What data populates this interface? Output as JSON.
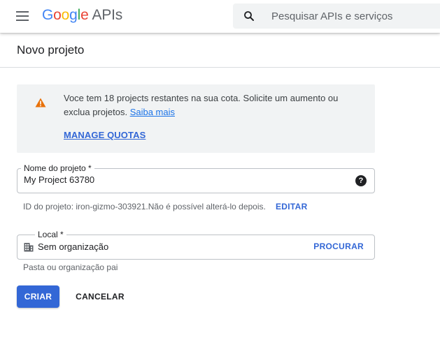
{
  "header": {
    "logo": {
      "letters": [
        "G",
        "o",
        "o",
        "g",
        "l",
        "e"
      ],
      "suffix": "APIs"
    },
    "search": {
      "placeholder": "Pesquisar APIs e serviços"
    }
  },
  "page": {
    "title": "Novo projeto"
  },
  "warning": {
    "text": "Voce tem 18 projects restantes na sua cota. Solicite um aumento ou exclua projetos.",
    "learn_more": "Saiba mais",
    "manage_quotas": "MANAGE QUOTAS",
    "icon": "warning-icon",
    "icon_color": "#e8710a"
  },
  "project_name": {
    "label": "Nome do projeto *",
    "value": "My Project 63780",
    "help_glyph": "?"
  },
  "project_id": {
    "text": "ID do projeto: iron-gizmo-303921.Não é possível alterá-lo depois.",
    "edit": "EDITAR"
  },
  "location": {
    "label": "Local *",
    "value": "Sem organização",
    "browse": "PROCURAR",
    "hint": "Pasta ou organização pai",
    "icon": "building-icon"
  },
  "actions": {
    "create": "CRIAR",
    "cancel": "CANCELAR"
  },
  "colors": {
    "accent": "#3367d6",
    "link": "#1a73e8",
    "banner_bg": "#f1f3f4"
  }
}
